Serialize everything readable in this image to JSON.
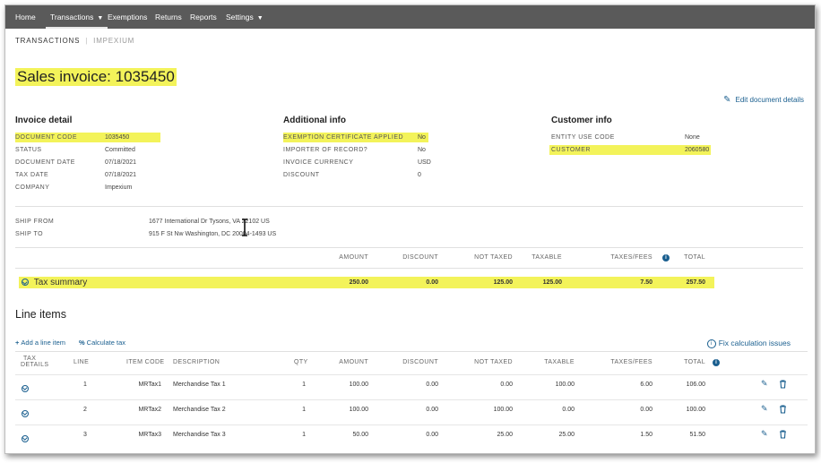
{
  "nav": {
    "items": [
      {
        "label": "Home",
        "active": false,
        "dropdown": false
      },
      {
        "label": "Transactions",
        "active": true,
        "dropdown": true
      },
      {
        "label": "Exemptions",
        "active": false,
        "dropdown": false
      },
      {
        "label": "Returns",
        "active": false,
        "dropdown": false
      },
      {
        "label": "Reports",
        "active": false,
        "dropdown": false
      },
      {
        "label": "Settings",
        "active": false,
        "dropdown": true
      }
    ],
    "caret": "▼"
  },
  "breadcrumb": {
    "section": "TRANSACTIONS",
    "separator": "|",
    "company": "IMPEXIUM"
  },
  "page": {
    "title": "Sales invoice: 1035450",
    "edit_label": "Edit document details"
  },
  "invoice_detail": {
    "title": "Invoice detail",
    "rows": [
      {
        "key": "DOCUMENT CODE",
        "value": "1035450"
      },
      {
        "key": "STATUS",
        "value": "Committed"
      },
      {
        "key": "DOCUMENT DATE",
        "value": "07/18/2021"
      },
      {
        "key": "TAX DATE",
        "value": "07/18/2021"
      },
      {
        "key": "COMPANY",
        "value": "Impexium"
      }
    ]
  },
  "additional_info": {
    "title": "Additional info",
    "rows": [
      {
        "key": "EXEMPTION CERTIFICATE APPLIED",
        "value": "No"
      },
      {
        "key": "IMPORTER OF RECORD?",
        "value": "No"
      },
      {
        "key": "INVOICE CURRENCY",
        "value": "USD"
      },
      {
        "key": "DISCOUNT",
        "value": "0"
      }
    ]
  },
  "customer_info": {
    "title": "Customer info",
    "rows": [
      {
        "key": "ENTITY USE CODE",
        "value": "None"
      },
      {
        "key": "CUSTOMER",
        "value": "2060580"
      }
    ]
  },
  "shipping": {
    "ship_from_label": "SHIP FROM",
    "ship_from": "1677 International Dr Tysons, VA 22102 US",
    "ship_to_label": "SHIP TO",
    "ship_to": "915 F St Nw Washington, DC 20004-1493 US"
  },
  "summary": {
    "headers": [
      "AMOUNT",
      "DISCOUNT",
      "NOT TAXED",
      "TAXABLE",
      "TAXES/FEES",
      "TOTAL"
    ],
    "label": "Tax summary",
    "values": [
      "250.00",
      "0.00",
      "125.00",
      "125.00",
      "7.50",
      "257.50"
    ]
  },
  "line_items": {
    "title": "Line items",
    "add_label": "Add a line item",
    "calc_label": "Calculate tax",
    "fix_label": "Fix calculation issues",
    "headers": {
      "tax_details_1": "TAX",
      "tax_details_2": "DETAILS",
      "line": "LINE",
      "item_code": "ITEM CODE",
      "description": "DESCRIPTION",
      "qty": "QTY",
      "amount": "AMOUNT",
      "discount": "DISCOUNT",
      "not_taxed": "NOT TAXED",
      "taxable": "TAXABLE",
      "taxes_fees": "TAXES/FEES",
      "total": "TOTAL"
    },
    "rows": [
      {
        "line": "1",
        "item_code": "MRTax1",
        "description": "Merchandise Tax 1",
        "qty": "1",
        "amount": "100.00",
        "discount": "0.00",
        "not_taxed": "0.00",
        "taxable": "100.00",
        "taxes_fees": "6.00",
        "total": "106.00"
      },
      {
        "line": "2",
        "item_code": "MRTax2",
        "description": "Merchandise Tax 2",
        "qty": "1",
        "amount": "100.00",
        "discount": "0.00",
        "not_taxed": "100.00",
        "taxable": "0.00",
        "taxes_fees": "0.00",
        "total": "100.00"
      },
      {
        "line": "3",
        "item_code": "MRTax3",
        "description": "Merchandise Tax 3",
        "qty": "1",
        "amount": "50.00",
        "discount": "0.00",
        "not_taxed": "25.00",
        "taxable": "25.00",
        "taxes_fees": "1.50",
        "total": "51.50"
      }
    ]
  },
  "colors": {
    "nav_bg": "#5a5a5a",
    "highlight": "#f3f35a",
    "link": "#1a5f8f"
  },
  "icons": {
    "edit": "pencil-icon",
    "delete": "trash-icon",
    "expand": "chevron-circle-icon",
    "info": "info-icon",
    "add": "plus-icon",
    "calc": "percent-icon"
  }
}
